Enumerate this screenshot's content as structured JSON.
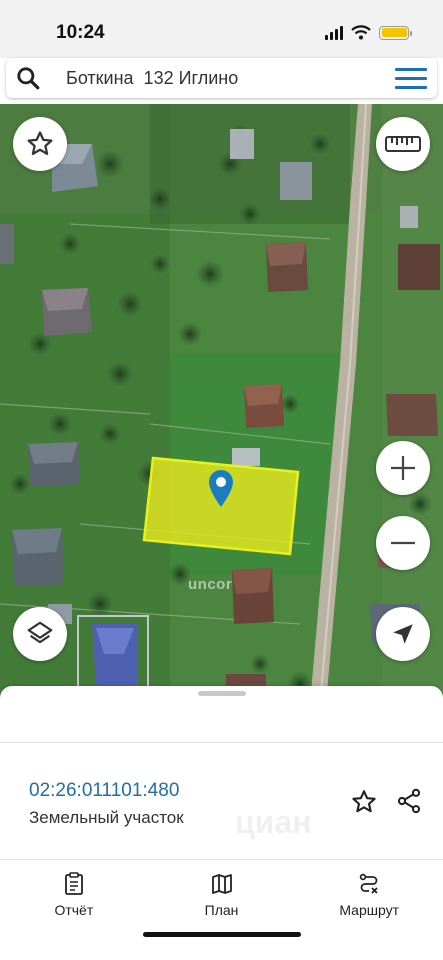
{
  "status_bar": {
    "time": "10:24",
    "battery_color": "#f5c400"
  },
  "search": {
    "query": "Боткина  132 Иглино",
    "icon": "search-icon",
    "menu_icon": "hamburger-menu-icon",
    "accent": "#1d6fb8"
  },
  "map": {
    "watermark": "uncor",
    "parcel_fill": "#e6e61e",
    "buttons": {
      "favorite": "star-icon",
      "ruler": "ruler-icon",
      "zoom_in": "plus-icon",
      "zoom_out": "minus-icon",
      "layers": "layers-icon",
      "locate": "navigation-arrow-icon"
    }
  },
  "sheet": {
    "cadastral_number": "02:26:011101:480",
    "object_type": "Земельный участок",
    "watermark": "циан",
    "link_color": "#1f6fa8"
  },
  "tabs": [
    {
      "label": "Отчёт",
      "icon": "report-clipboard-icon"
    },
    {
      "label": "План",
      "icon": "map-plan-icon"
    },
    {
      "label": "Маршрут",
      "icon": "route-icon"
    }
  ]
}
